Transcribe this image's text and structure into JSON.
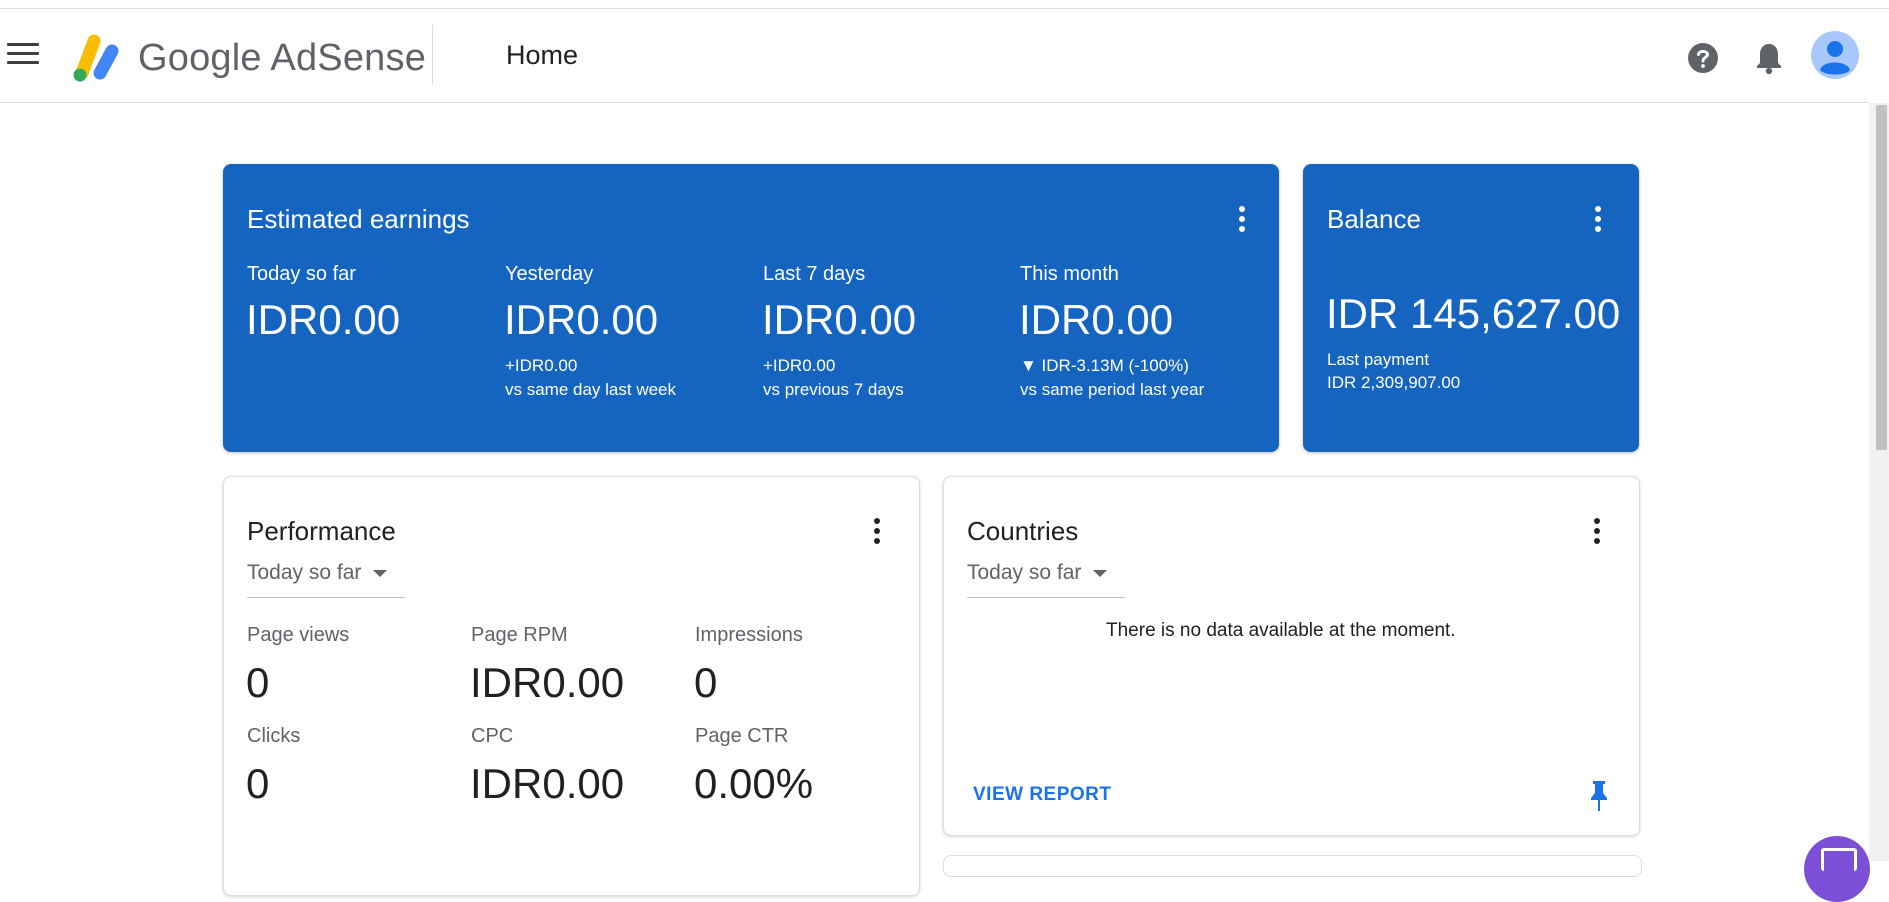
{
  "header": {
    "brand": "Google AdSense",
    "page_title": "Home",
    "icons": [
      "menu-icon",
      "adsense-logo",
      "help-icon",
      "notifications-icon",
      "account-avatar"
    ]
  },
  "estimated_earnings": {
    "title": "Estimated earnings",
    "stats": [
      {
        "label": "Today so far",
        "value": "IDR0.00",
        "delta": "",
        "compare": ""
      },
      {
        "label": "Yesterday",
        "value": "IDR0.00",
        "delta": "+IDR0.00",
        "compare": "vs same day last week"
      },
      {
        "label": "Last 7 days",
        "value": "IDR0.00",
        "delta": "+IDR0.00",
        "compare": "vs previous 7 days"
      },
      {
        "label": "This month",
        "value": "IDR0.00",
        "delta": "▼ IDR-3.13M (-100%)",
        "compare": "vs same period last year"
      }
    ]
  },
  "balance": {
    "title": "Balance",
    "value": "IDR 145,627.00",
    "last_payment_label": "Last payment",
    "last_payment_value": "IDR 2,309,907.00"
  },
  "performance": {
    "title": "Performance",
    "range": "Today so far",
    "metrics": [
      {
        "label": "Page views",
        "value": "0"
      },
      {
        "label": "Page RPM",
        "value": "IDR0.00"
      },
      {
        "label": "Impressions",
        "value": "0"
      },
      {
        "label": "Clicks",
        "value": "0"
      },
      {
        "label": "CPC",
        "value": "IDR0.00"
      },
      {
        "label": "Page CTR",
        "value": "0.00%"
      }
    ]
  },
  "countries": {
    "title": "Countries",
    "range": "Today so far",
    "empty_message": "There is no data available at the moment.",
    "view_report": "VIEW REPORT"
  },
  "colors": {
    "brand_blue": "#1565c0",
    "link_blue": "#1a73e8",
    "fab_purple": "#7b4fd6"
  }
}
